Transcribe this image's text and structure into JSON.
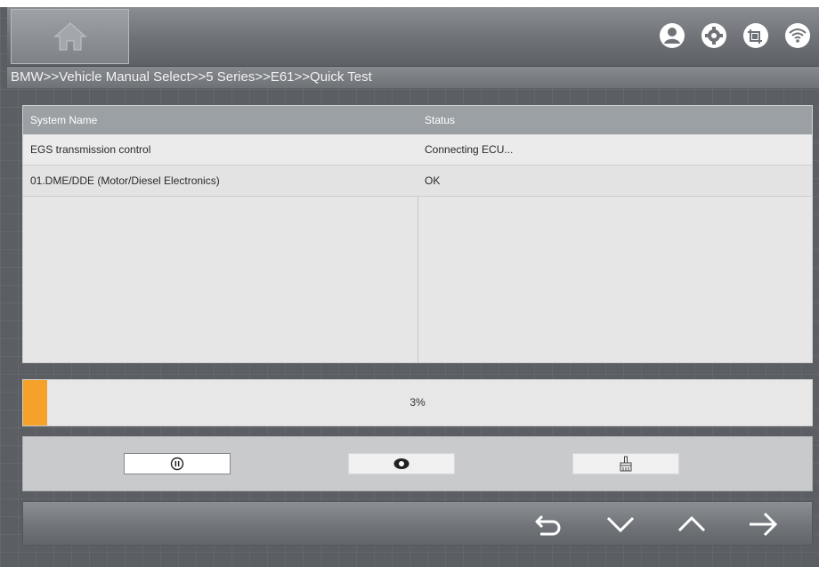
{
  "breadcrumb": "BMW>>Vehicle Manual Select>>5 Series>>E61>>Quick Test",
  "header": {
    "icons": [
      "home-icon",
      "user-icon",
      "settings-icon",
      "screenshot-icon",
      "wifi-icon"
    ]
  },
  "table": {
    "columns": [
      "System Name",
      "Status"
    ],
    "rows": [
      {
        "system": "EGS transmission control",
        "status": "Connecting ECU..."
      },
      {
        "system": "01.DME/DDE (Motor/Diesel Electronics)",
        "status": "OK"
      }
    ]
  },
  "progress": {
    "percent": 3,
    "label": "3%"
  },
  "actions": {
    "icons": [
      "pause-icon",
      "view-icon",
      "clear-icon"
    ]
  },
  "footer": {
    "icons": [
      "back-icon",
      "scroll-down-icon",
      "scroll-up-icon",
      "next-icon"
    ]
  },
  "colors": {
    "accent": "#f5a12a",
    "header": "#6e7276",
    "table_header": "#9ba0a4"
  }
}
